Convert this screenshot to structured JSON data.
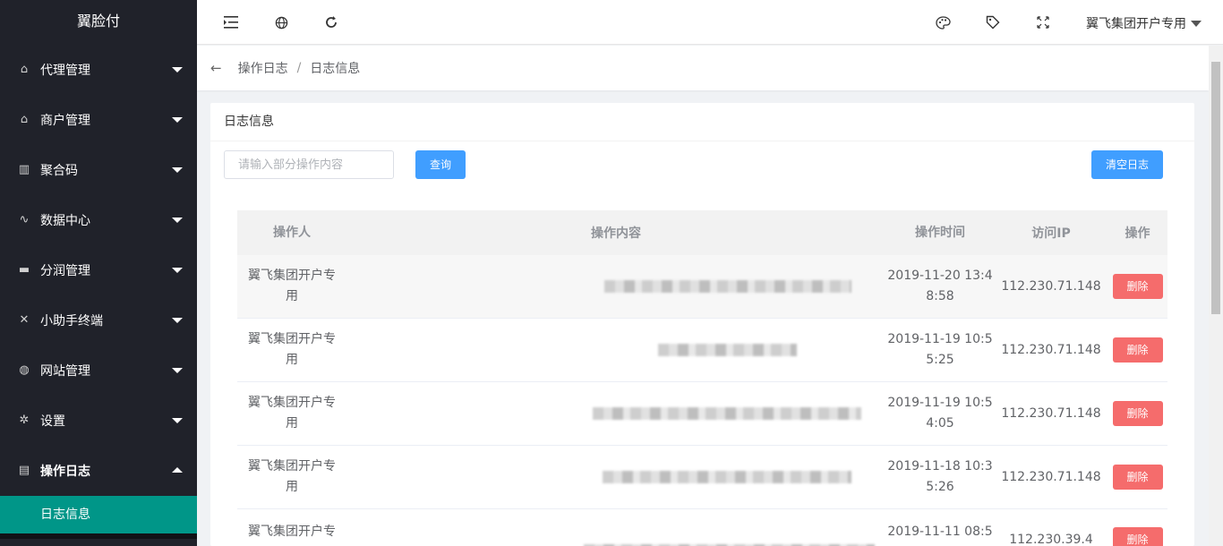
{
  "app": {
    "logo": "翼脸付"
  },
  "sidebar": {
    "items": [
      {
        "label": "代理管理",
        "icon": "home-icon"
      },
      {
        "label": "商户管理",
        "icon": "home-icon"
      },
      {
        "label": "聚合码",
        "icon": "barcode-icon"
      },
      {
        "label": "数据中心",
        "icon": "pulse-icon"
      },
      {
        "label": "分润管理",
        "icon": "monitor-icon"
      },
      {
        "label": "小助手终端",
        "icon": "tools-icon"
      },
      {
        "label": "网站管理",
        "icon": "globe-icon"
      },
      {
        "label": "设置",
        "icon": "gear-icon"
      },
      {
        "label": "操作日志",
        "icon": "log-icon"
      }
    ],
    "subitem": "日志信息"
  },
  "header": {
    "user": "翼飞集团开户专用"
  },
  "breadcrumb": {
    "parent": "操作日志",
    "separator": "/",
    "current": "日志信息"
  },
  "card": {
    "title": "日志信息",
    "search_placeholder": "请输入部分操作内容",
    "search_value": "",
    "search_button": "查询",
    "clear_button": "清空日志"
  },
  "table": {
    "headers": [
      "操作人",
      "操作内容",
      "操作时间",
      "访问IP",
      "操作"
    ],
    "rows": [
      {
        "operator_l1": "翼飞集团开户专",
        "operator_l2": "用",
        "time_l1": "2019-11-20 13:4",
        "time_l2": "8:58",
        "ip": "112.230.71.148",
        "action": "删除"
      },
      {
        "operator_l1": "翼飞集团开户专",
        "operator_l2": "用",
        "time_l1": "2019-11-19 10:5",
        "time_l2": "5:25",
        "ip": "112.230.71.148",
        "action": "删除"
      },
      {
        "operator_l1": "翼飞集团开户专",
        "operator_l2": "用",
        "time_l1": "2019-11-19 10:5",
        "time_l2": "4:05",
        "ip": "112.230.71.148",
        "action": "删除"
      },
      {
        "operator_l1": "翼飞集团开户专",
        "operator_l2": "用",
        "time_l1": "2019-11-18 10:3",
        "time_l2": "5:26",
        "ip": "112.230.71.148",
        "action": "删除"
      },
      {
        "operator_l1": "翼飞集团开户专",
        "operator_l2": "",
        "time_l1": "2019-11-11 08:5",
        "time_l2": "",
        "ip": "112.230.39.4",
        "action": "删除"
      }
    ]
  },
  "colors": {
    "sidebar_bg": "#20222a",
    "active_sub": "#009688",
    "primary": "#409eff",
    "danger": "#f56c6c"
  }
}
